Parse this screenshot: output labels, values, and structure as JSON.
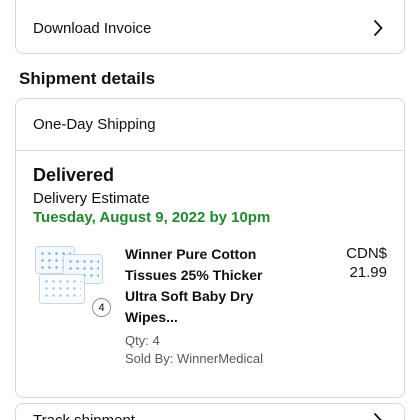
{
  "invoice": {
    "label": "Download Invoice"
  },
  "shipment_section": {
    "title": "Shipment details"
  },
  "shipment": {
    "method": "One-Day Shipping",
    "status": "Delivered",
    "estimate_label": "Delivery Estimate",
    "estimate_date": "Tuesday, August 9, 2022 by 10pm",
    "status_color": "#1e8a2e",
    "item": {
      "title": "Winner Pure Cotton Tissues 25% Thicker Ultra Soft Baby Dry Wipes...",
      "qty": "Qty: 4",
      "sold_by": "Sold By: WinnerMedical",
      "price_currency": "CDN$",
      "price_value": "21.99",
      "badge_count": "4"
    }
  },
  "track": {
    "label": "Track shipment"
  },
  "icons": {
    "row_chevron": "chevron-right-icon"
  }
}
